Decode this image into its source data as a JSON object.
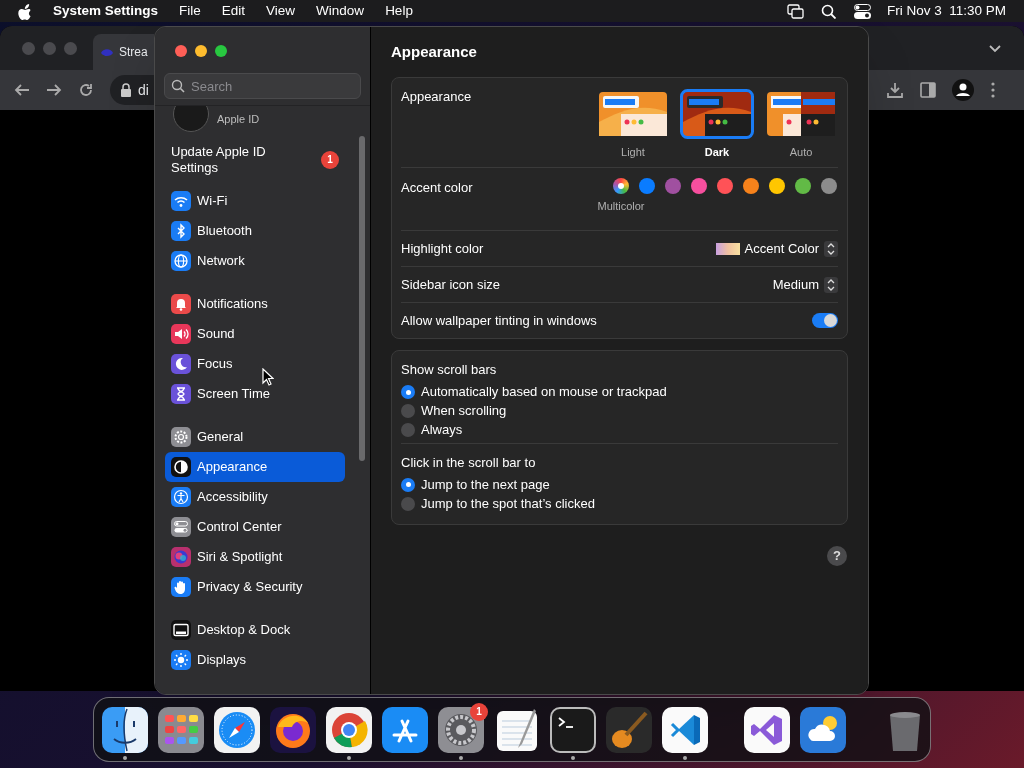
{
  "menubar": {
    "app": "System Settings",
    "menus": [
      "File",
      "Edit",
      "View",
      "Window",
      "Help"
    ],
    "clock": "Fri Nov 3  11:30 PM"
  },
  "browser": {
    "tab_title": "Strea",
    "url": "di"
  },
  "sidebar": {
    "search": {
      "placeholder": "Search"
    },
    "apple_id_label": "Apple ID",
    "update": {
      "label": "Update Apple ID Settings",
      "badge": "1"
    },
    "groups": [
      [
        {
          "label": "Wi-Fi",
          "kind": "wifi",
          "color": "#1a7cf5",
          "selected": false
        },
        {
          "label": "Bluetooth",
          "kind": "bluetooth",
          "color": "#1a7cf5",
          "selected": false
        },
        {
          "label": "Network",
          "kind": "globe",
          "color": "#1a7cf5",
          "selected": false
        }
      ],
      [
        {
          "label": "Notifications",
          "kind": "bell",
          "color": "#eb4a4a",
          "selected": false
        },
        {
          "label": "Sound",
          "kind": "speaker",
          "color": "#e8375a",
          "selected": false
        },
        {
          "label": "Focus",
          "kind": "moon",
          "color": "#6a52d9",
          "selected": false
        },
        {
          "label": "Screen Time",
          "kind": "hourglass",
          "color": "#6a52d9",
          "selected": false
        }
      ],
      [
        {
          "label": "General",
          "kind": "gear",
          "color": "#8e8e93",
          "selected": false
        },
        {
          "label": "Appearance",
          "kind": "contrast",
          "color": "#111111",
          "selected": true
        },
        {
          "label": "Accessibility",
          "kind": "person",
          "color": "#1a7cf5",
          "selected": false
        },
        {
          "label": "Control Center",
          "kind": "toggles",
          "color": "#8e8e93",
          "selected": false
        },
        {
          "label": "Siri & Spotlight",
          "kind": "orb",
          "color": "#b8306e",
          "selected": false
        },
        {
          "label": "Privacy & Security",
          "kind": "hand",
          "color": "#1a7cf5",
          "selected": false
        }
      ],
      [
        {
          "label": "Desktop & Dock",
          "kind": "dock",
          "color": "#111111",
          "selected": false
        },
        {
          "label": "Displays",
          "kind": "sun",
          "color": "#1a7cf5",
          "selected": false
        }
      ]
    ]
  },
  "content": {
    "title": "Appearance",
    "appearance": {
      "label": "Appearance",
      "options": [
        {
          "label": "Light",
          "kind": "light",
          "selected": false
        },
        {
          "label": "Dark",
          "kind": "dark",
          "selected": true
        },
        {
          "label": "Auto",
          "kind": "auto",
          "selected": false
        }
      ]
    },
    "accent": {
      "label": "Accent color",
      "swatches": [
        {
          "kind": "multicolor",
          "label": "Multicolor",
          "selected": true
        },
        {
          "kind": "solid",
          "color": "#0a7cff",
          "selected": false
        },
        {
          "kind": "solid",
          "color": "#a050a0",
          "selected": false
        },
        {
          "kind": "solid",
          "color": "#f74f9e",
          "selected": false
        },
        {
          "kind": "solid",
          "color": "#ff5257",
          "selected": false
        },
        {
          "kind": "solid",
          "color": "#f7821b",
          "selected": false
        },
        {
          "kind": "solid",
          "color": "#ffc600",
          "selected": false
        },
        {
          "kind": "solid",
          "color": "#62ba46",
          "selected": false
        },
        {
          "kind": "solid",
          "color": "#8c8c8c",
          "selected": false
        }
      ]
    },
    "highlight": {
      "label": "Highlight color",
      "value": "Accent Color"
    },
    "icon_size": {
      "label": "Sidebar icon size",
      "value": "Medium"
    },
    "tinting": {
      "label": "Allow wallpaper tinting in windows",
      "on": true
    },
    "scroll_groups": [
      {
        "label": "Show scroll bars",
        "options": [
          {
            "label": "Automatically based on mouse or trackpad",
            "selected": true
          },
          {
            "label": "When scrolling",
            "selected": false
          },
          {
            "label": "Always",
            "selected": false
          }
        ]
      },
      {
        "label": "Click in the scroll bar to",
        "options": [
          {
            "label": "Jump to the next page",
            "selected": true
          },
          {
            "label": "Jump to the spot that’s clicked",
            "selected": false
          }
        ]
      }
    ],
    "help": "?"
  },
  "dock": {
    "groups": [
      [
        {
          "kind": "finder",
          "running": true
        },
        {
          "kind": "launchpad",
          "running": false
        },
        {
          "kind": "safari",
          "running": false
        },
        {
          "kind": "firefox",
          "running": false
        },
        {
          "kind": "chrome",
          "running": true
        },
        {
          "kind": "appstore",
          "running": false
        },
        {
          "kind": "settings",
          "running": true,
          "badge": "1"
        },
        {
          "kind": "textedit",
          "running": false
        },
        {
          "kind": "terminal",
          "running": true
        },
        {
          "kind": "guitar",
          "running": false
        },
        {
          "kind": "vscode",
          "running": true
        }
      ],
      [
        {
          "kind": "vs",
          "running": false
        },
        {
          "kind": "weather",
          "running": false
        }
      ],
      [
        {
          "kind": "trash",
          "running": false
        }
      ]
    ]
  }
}
